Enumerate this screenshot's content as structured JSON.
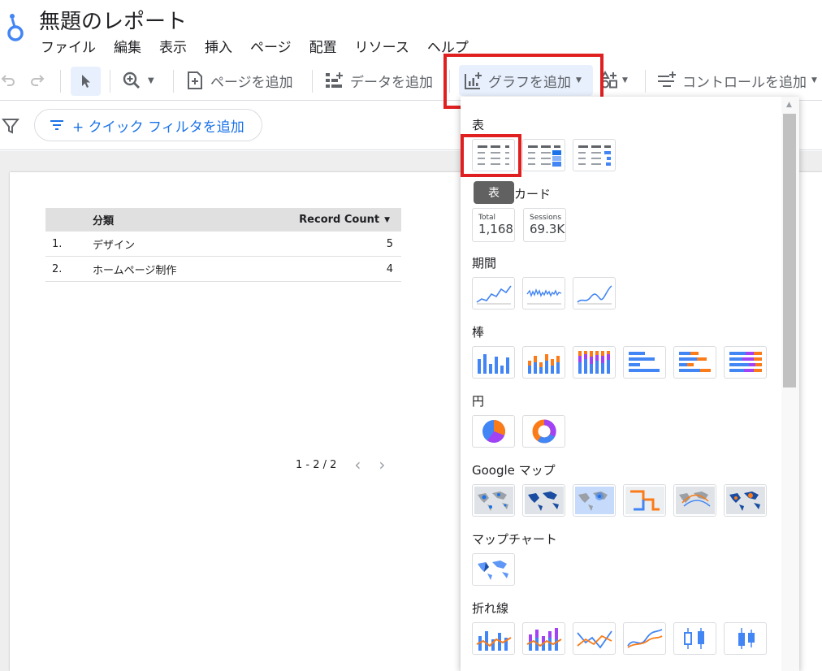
{
  "doc": {
    "title": "無題のレポート",
    "menu": [
      "ファイル",
      "編集",
      "表示",
      "挿入",
      "ページ",
      "配置",
      "リソース",
      "ヘルプ"
    ]
  },
  "toolbar": {
    "add_page": "ページを追加",
    "add_data": "データを追加",
    "add_chart": "グラフを追加",
    "add_control": "コントロールを追加"
  },
  "filter": {
    "quick_filter": "+ クイック フィルタを追加"
  },
  "table": {
    "headers": {
      "category": "分類",
      "count": "Record Count"
    },
    "rows": [
      {
        "idx": "1.",
        "name": "デザイン",
        "value": "5"
      },
      {
        "idx": "2.",
        "name": "ホームページ制作",
        "value": "4"
      }
    ],
    "pagination": "1 - 2 / 2"
  },
  "panel": {
    "sections": {
      "table": "表",
      "scorecard": "カード",
      "timeseries": "期間",
      "bar": "棒",
      "pie": "円",
      "google_maps": "Google マップ",
      "map_chart": "マップチャート",
      "line": "折れ線"
    },
    "tooltip": "表",
    "scorecards": [
      {
        "label": "Total",
        "value": "1,168"
      },
      {
        "label": "Sessions",
        "value": "69.3K"
      }
    ]
  },
  "colors": {
    "accent": "#1a73e8",
    "highlight": "#e02020",
    "bar_blue": "#4285f4",
    "bar_orange": "#fa7b17",
    "bar_purple": "#a142f4"
  }
}
